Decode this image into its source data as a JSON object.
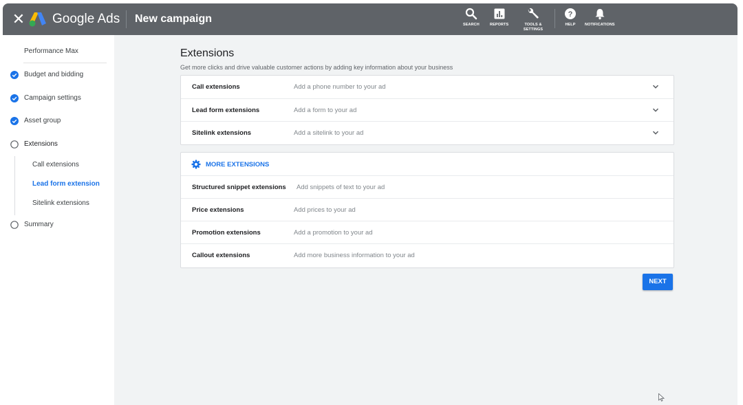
{
  "header": {
    "close_icon": "close-icon",
    "brand": "Google Ads",
    "title": "New campaign",
    "tools": [
      {
        "icon": "search-icon",
        "label": "SEARCH"
      },
      {
        "icon": "reports-icon",
        "label": "REPORTS"
      },
      {
        "icon": "wrench-icon",
        "label": "TOOLS & SETTINGS"
      },
      {
        "icon": "help-icon",
        "label": "HELP"
      },
      {
        "icon": "bell-icon",
        "label": "NOTIFICATIONS"
      }
    ]
  },
  "sidebar": {
    "campaign_type": "Performance Max",
    "steps": [
      {
        "label": "Budget and bidding",
        "status": "complete"
      },
      {
        "label": "Campaign settings",
        "status": "complete"
      },
      {
        "label": "Asset group",
        "status": "complete"
      },
      {
        "label": "Extensions",
        "status": "current"
      }
    ],
    "substeps": [
      {
        "label": "Call extensions",
        "active": false
      },
      {
        "label": "Lead form extension",
        "active": true
      },
      {
        "label": "Sitelink extensions",
        "active": false
      }
    ],
    "last_step": {
      "label": "Summary",
      "status": "incomplete"
    }
  },
  "main": {
    "title": "Extensions",
    "subtitle": "Get more clicks and drive valuable customer actions by adding key information about your business",
    "extensions": [
      {
        "name": "Call extensions",
        "desc": "Add a phone number to your ad"
      },
      {
        "name": "Lead form extensions",
        "desc": "Add a form to your ad"
      },
      {
        "name": "Sitelink extensions",
        "desc": "Add a sitelink to your ad"
      }
    ],
    "more_label": "MORE EXTENSIONS",
    "more_extensions": [
      {
        "name": "Structured snippet extensions",
        "desc": "Add snippets of text to your ad"
      },
      {
        "name": "Price extensions",
        "desc": "Add prices to your ad"
      },
      {
        "name": "Promotion extensions",
        "desc": "Add a promotion to your ad"
      },
      {
        "name": "Callout extensions",
        "desc": "Add more business information to your ad"
      }
    ],
    "next_label": "NEXT"
  },
  "colors": {
    "accent": "#1a73e8",
    "header_bg": "#5f6368",
    "page_bg": "#f1f3f4"
  }
}
